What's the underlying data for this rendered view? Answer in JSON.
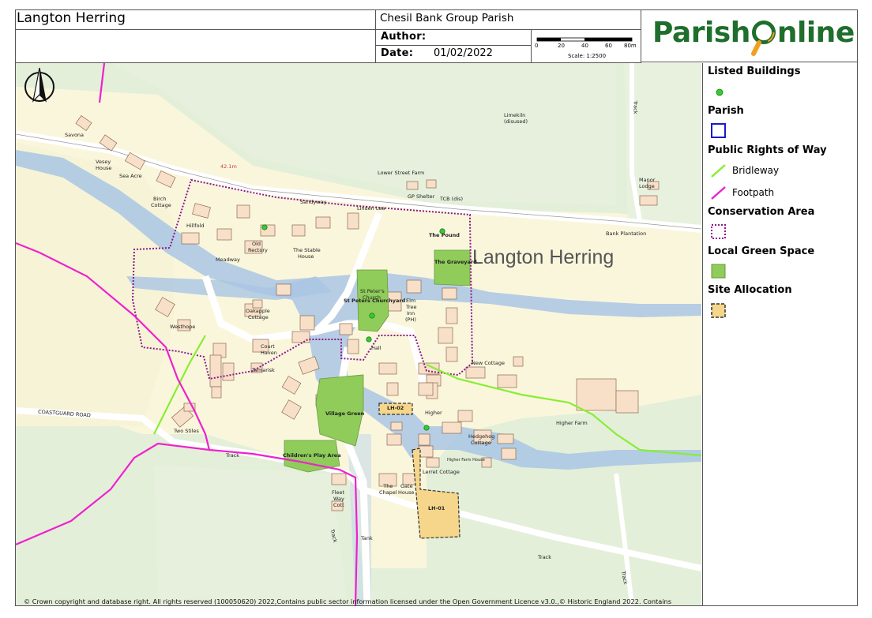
{
  "header": {
    "map_title": "Langton Herring",
    "parish": "Chesil Bank Group Parish",
    "author_label": "Author:",
    "author_value": "",
    "date_label": "Date:",
    "date_value": "01/02/2022",
    "scale_ticks": [
      "0",
      "20",
      "40",
      "60",
      "80m"
    ],
    "scale_text": "Scale: 1:2500"
  },
  "logo": {
    "text_before": "Parish",
    "text_after": "nline"
  },
  "legend": {
    "listed_buildings": "Listed Buildings",
    "parish": "Parish",
    "prow": "Public Rights of Way",
    "bridleway": "Bridleway",
    "footpath": "Footpath",
    "conservation": "Conservation Area",
    "green_space": "Local Green Space",
    "site_allocation": "Site Allocation"
  },
  "colors": {
    "listed": "#33cc33",
    "parish": "#1a1acc",
    "bridleway": "#88ee33",
    "footpath": "#ee22cc",
    "conservation": "#8b1a8b",
    "green_space": "#8fcc5a",
    "site_allocation": "#f5d68a"
  },
  "map_labels": {
    "village": "Langton Herring",
    "savona": "Savona",
    "vesey": "Vesey",
    "vesey_house": "House",
    "sea_acre": "Sea Acre",
    "spot_height": "42.1m",
    "birch": "Birch",
    "birch_cottage": "Cottage",
    "lower_street_farm": "Lower Street Farm",
    "gp_shelter": "GP Shelter",
    "tcb": "TCB (dis)",
    "limekiln": "Limekiln",
    "limekiln_disused": "(disused)",
    "track_ne": "Track",
    "manor": "Manor",
    "manor_lodge": "Lodge",
    "bank_plantation": "Bank Plantation",
    "sandyway": "Sandyway",
    "linden_lea": "Linden Lea",
    "hillfold": "Hillfold",
    "old": "Old",
    "old_rectory": "Rectory",
    "the_stable": "The Stable",
    "the_stable_house": "House",
    "meadway": "Meadway",
    "the_pound": "The Pound",
    "the_graveyard": "The Graveyard",
    "st_peters": "St Peter's",
    "st_peters_church": "Church",
    "churchyard": "St Peters Churchyard",
    "elm": "Elm",
    "elm_tree": "Tree",
    "elm_inn": "Inn",
    "elm_ph": "(PH)",
    "oakapple": "Oakapple",
    "oakapple_cottage": "Cottage",
    "westhope": "Westhope",
    "court": "Court",
    "court_haven": "Haven",
    "tamarisk": "Tamarisk",
    "new_cottage": "New Cottage",
    "coastguard_road": "COASTGUARD ROAD",
    "two_stiles": "Two Stiles",
    "village_green": "Village Green",
    "lh02": "LH-02",
    "higher": "Higher",
    "hedgehog": "Hedgehog",
    "hedgehog_cottage": "Cottage",
    "higher_farm_house": "Higher Farm House",
    "higher_farm": "Higher Farm",
    "childrens_play": "Children's Play Area",
    "track_s": "Track",
    "lerret": "Lerret Cottage",
    "fleet": "Fleet",
    "fleet_way": "Way",
    "fleet_cott": "Cott",
    "the_chapel": "The\nChapel",
    "gate": "Gate",
    "gate_house": "House",
    "lh01": "LH-01",
    "track_w": "Track",
    "tank": "Tank",
    "track_bottom": "Track",
    "track_se": "Track",
    "hall": "Hall"
  },
  "copyright": "© Crown copyright and database right. All rights reserved (100050620) 2022,Contains public sector information licensed under the Open Government Licence v3.0.,© Historic England 2022. Contains"
}
